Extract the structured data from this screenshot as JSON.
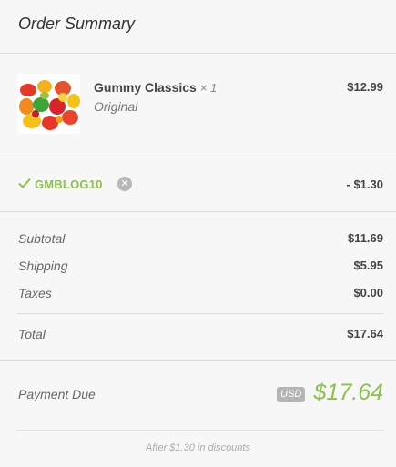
{
  "header": {
    "title": "Order Summary"
  },
  "item": {
    "name": "Gummy Classics",
    "qty": "× 1",
    "variant": "Original",
    "price": "$12.99",
    "image_icon": "gummy-candies-image"
  },
  "discount": {
    "code": "GMBLOG10",
    "amount": "- $1.30",
    "check_icon": "checkmark-icon",
    "remove_icon": "close-circle-icon"
  },
  "totals": {
    "subtotal_label": "Subtotal",
    "subtotal": "$11.69",
    "shipping_label": "Shipping",
    "shipping": "$5.95",
    "taxes_label": "Taxes",
    "taxes": "$0.00",
    "total_label": "Total",
    "total": "$17.64"
  },
  "payment": {
    "label": "Payment Due",
    "currency": "USD",
    "amount": "$17.64",
    "note": "After $1.30 in discounts"
  },
  "colors": {
    "accent_green": "#8dc04d",
    "text_dark": "#444444",
    "background": "#f7f7f7"
  }
}
